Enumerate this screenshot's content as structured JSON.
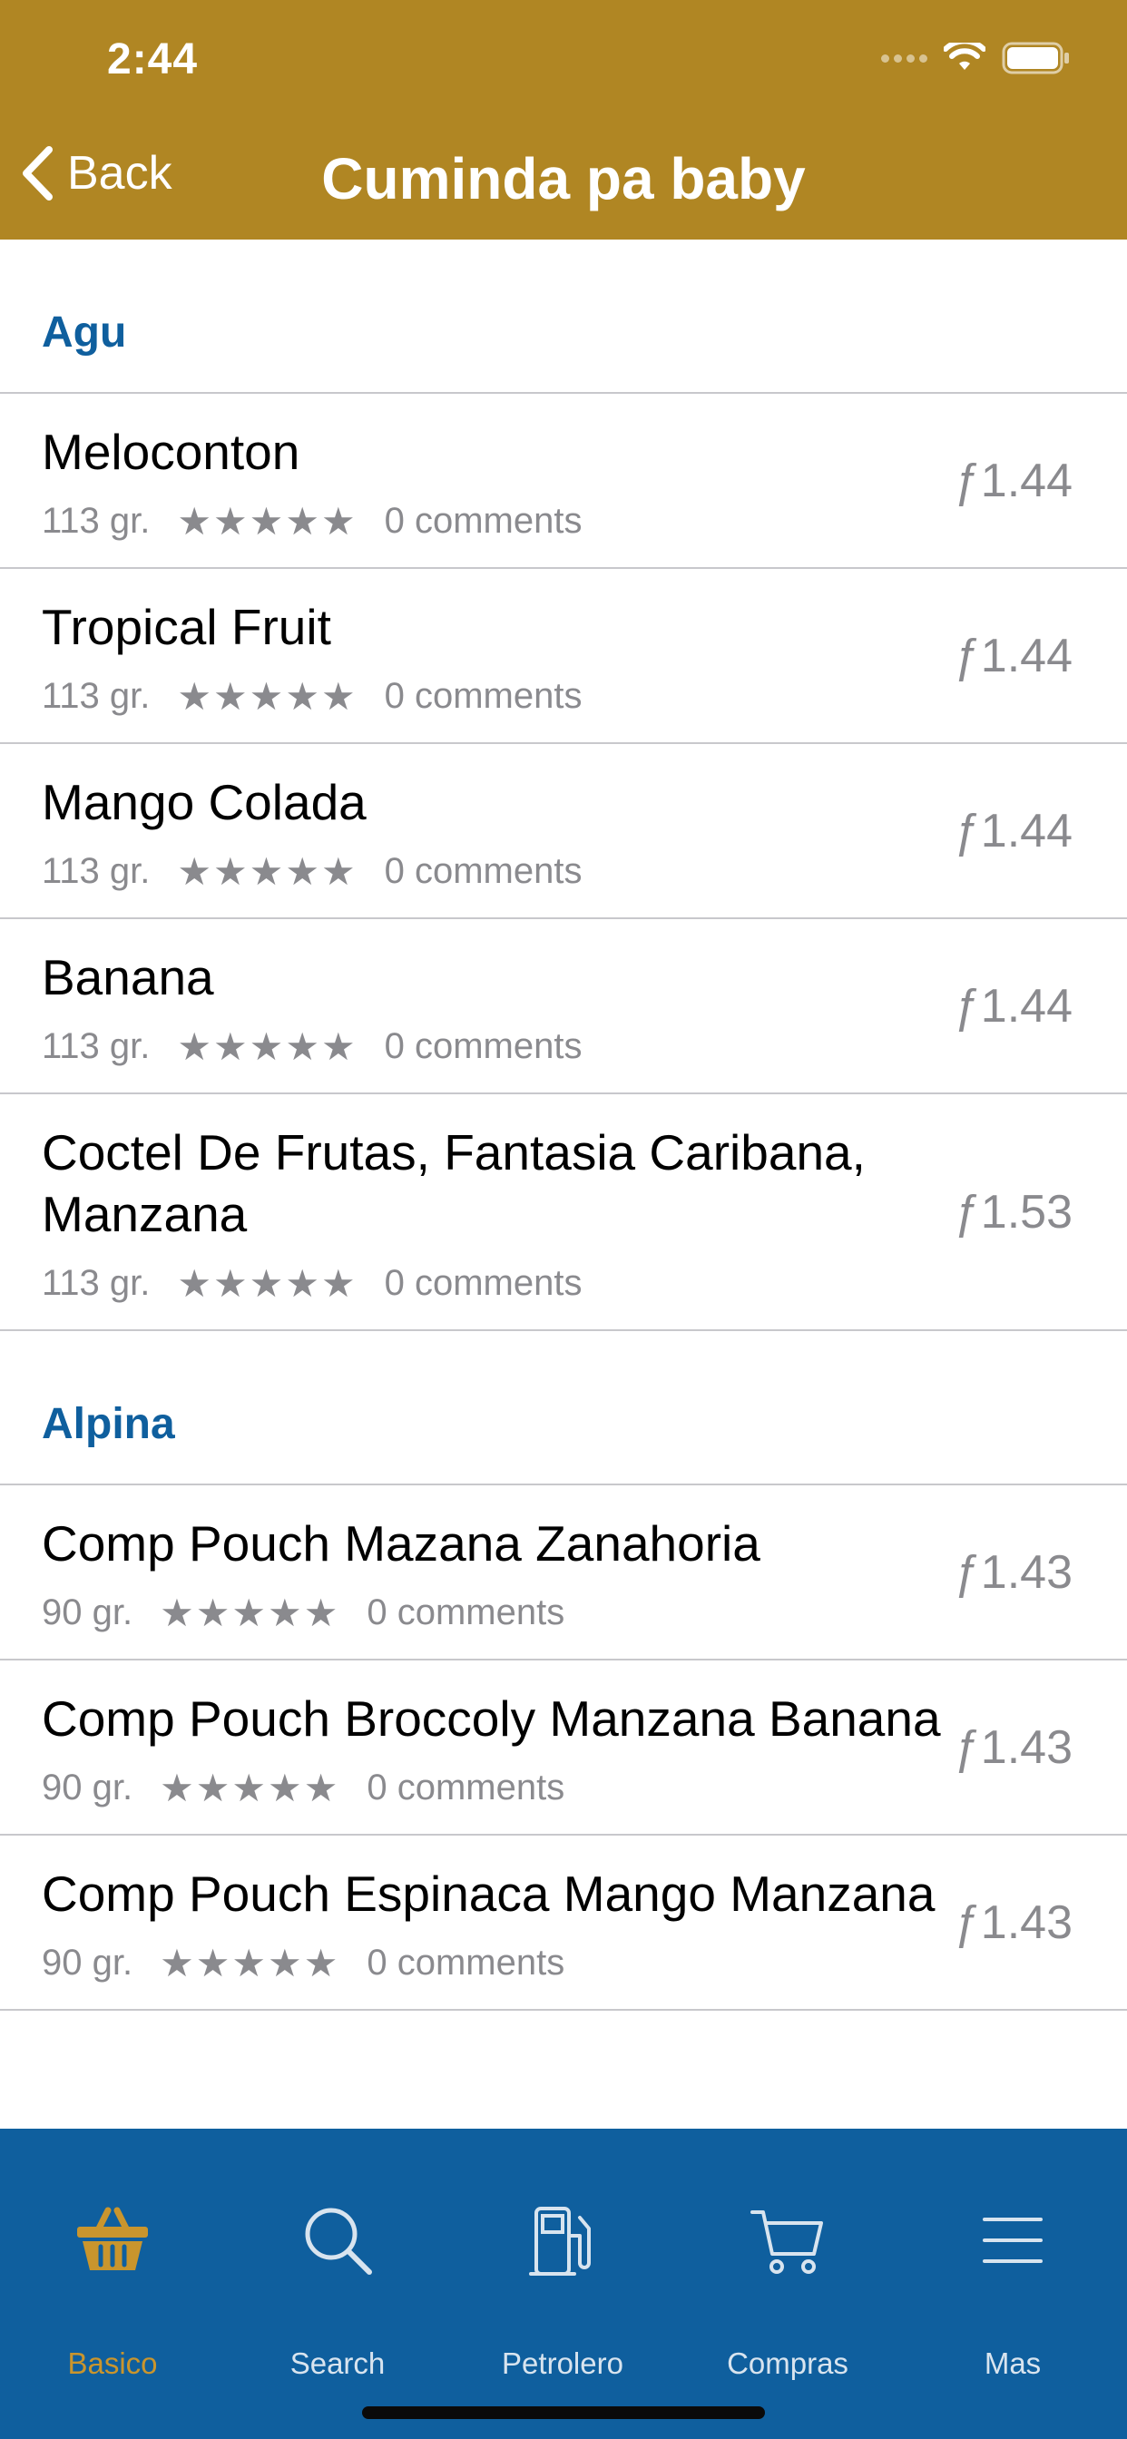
{
  "status_bar": {
    "time": "2:44"
  },
  "nav": {
    "back_label": "Back",
    "title": "Cuminda pa baby"
  },
  "colors": {
    "header": "#b08623",
    "section_title": "#0f5f9e",
    "tabbar": "#0f5f9e",
    "active_tab": "#c9952d"
  },
  "sections": [
    {
      "title": "Agu",
      "items": [
        {
          "name": "Meloconton",
          "weight": "113 gr.",
          "stars": "★★★★★",
          "comments": "0 comments",
          "price": "ƒ1.44"
        },
        {
          "name": "Tropical Fruit",
          "weight": "113 gr.",
          "stars": "★★★★★",
          "comments": "0 comments",
          "price": "ƒ1.44"
        },
        {
          "name": "Mango Colada",
          "weight": "113 gr.",
          "stars": "★★★★★",
          "comments": "0 comments",
          "price": "ƒ1.44"
        },
        {
          "name": "Banana",
          "weight": "113 gr.",
          "stars": "★★★★★",
          "comments": "0 comments",
          "price": "ƒ1.44"
        },
        {
          "name": "Coctel De Frutas, Fantasia Caribana, Manzana",
          "weight": "113 gr.",
          "stars": "★★★★★",
          "comments": "0 comments",
          "price": "ƒ1.53"
        }
      ]
    },
    {
      "title": "Alpina",
      "items": [
        {
          "name": "Comp Pouch Mazana Zanahoria",
          "weight": "90 gr.",
          "stars": "★★★★★",
          "comments": "0 comments",
          "price": "ƒ1.43"
        },
        {
          "name": "Comp Pouch Broccoly Manzana Banana",
          "weight": "90 gr.",
          "stars": "★★★★★",
          "comments": "0 comments",
          "price": "ƒ1.43"
        },
        {
          "name": "Comp Pouch Espinaca Mango Manzana",
          "weight": "90 gr.",
          "stars": "★★★★★",
          "comments": "0 comments",
          "price": "ƒ1.43"
        }
      ]
    }
  ],
  "tabs": [
    {
      "label": "Basico",
      "icon": "basket-icon",
      "active": true
    },
    {
      "label": "Search",
      "icon": "search-icon",
      "active": false
    },
    {
      "label": "Petrolero",
      "icon": "fuel-pump-icon",
      "active": false
    },
    {
      "label": "Compras",
      "icon": "cart-icon",
      "active": false
    },
    {
      "label": "Mas",
      "icon": "menu-icon",
      "active": false
    }
  ]
}
